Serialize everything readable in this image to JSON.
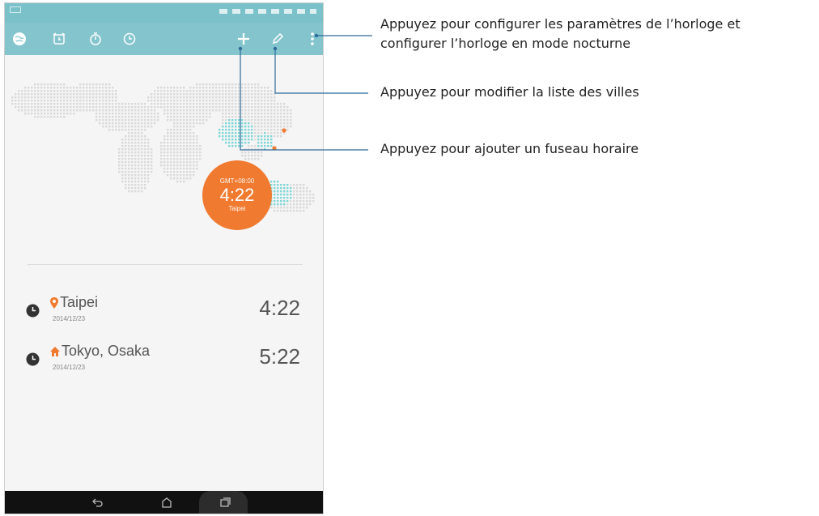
{
  "toolbar": {
    "icons": [
      "world-clock-icon",
      "alarm-icon",
      "stopwatch-icon",
      "timer-icon",
      "add-icon",
      "edit-icon",
      "more-icon"
    ]
  },
  "map": {
    "gmt": "GMT+08:00",
    "time": "4:22",
    "city": "Taipei"
  },
  "cities": [
    {
      "name": "Taipei",
      "date": "2014/12/23",
      "time": "4:22",
      "marker": "location-pin-icon"
    },
    {
      "name": "Tokyo, Osaka",
      "date": "2014/12/23",
      "time": "5:22",
      "marker": "home-icon"
    }
  ],
  "callouts": {
    "settings_line1": "Appuyez pour configurer les paramètres de l’horloge et",
    "settings_line2": "configurer l’horloge en mode nocturne",
    "edit": "Appuyez pour modifier la liste des villes",
    "add": "Appuyez pour ajouter un fuseau horaire"
  },
  "colors": {
    "toolbar": "#84c5cd",
    "accent": "#f07a30",
    "map_dots": "#d9d9d9",
    "highlight_dots": "#7fd6d6",
    "callout_line": "#2f6b9a"
  }
}
